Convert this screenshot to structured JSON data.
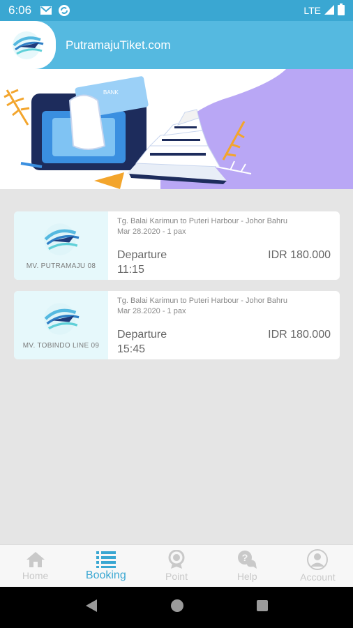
{
  "status_bar": {
    "time": "6:06",
    "network": "LTE",
    "icons": [
      "gmail-icon",
      "sync-icon",
      "signal-icon",
      "battery-icon"
    ]
  },
  "app_bar": {
    "title": "PutramajuTiket.com",
    "logo_icon": "ship-logo-icon"
  },
  "banner": {
    "card_text": "BANK",
    "accent_color": "#b9a7f5"
  },
  "bookings": [
    {
      "ship_name": "MV. PUTRAMAJU 08",
      "route": "Tg. Balai Karimun to Puteri Harbour - Johor Bahru",
      "date_pax": "Mar 28.2020 - 1 pax",
      "departure_label": "Departure",
      "departure_time": "11:15",
      "price": "IDR 180.000"
    },
    {
      "ship_name": "MV. TOBINDO LINE 09",
      "route": "Tg. Balai Karimun to Puteri Harbour - Johor Bahru",
      "date_pax": "Mar 28.2020 - 1 pax",
      "departure_label": "Departure",
      "departure_time": "15:45",
      "price": "IDR 180.000"
    }
  ],
  "bottom_nav": {
    "items": [
      {
        "label": "Home",
        "icon": "home-icon",
        "active": false
      },
      {
        "label": "Booking",
        "icon": "list-icon",
        "active": true
      },
      {
        "label": "Point",
        "icon": "badge-icon",
        "active": false
      },
      {
        "label": "Help",
        "icon": "help-icon",
        "active": false
      },
      {
        "label": "Account",
        "icon": "account-icon",
        "active": false
      }
    ]
  },
  "colors": {
    "primary": "#3aa7d2",
    "appbar": "#55b9e0",
    "card_left_bg": "#e6f8fb",
    "inactive_nav": "#c9c9c9"
  }
}
